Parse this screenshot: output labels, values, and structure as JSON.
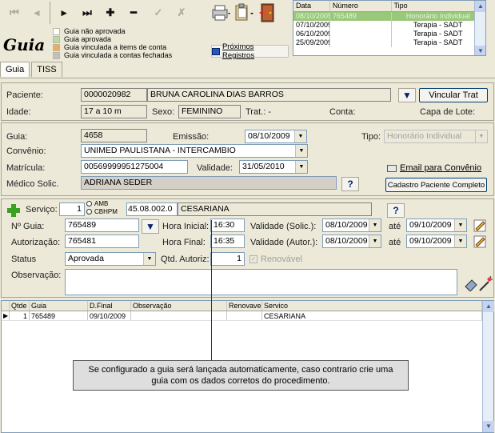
{
  "toolbar": {
    "buttons": [
      {
        "name": "first-icon",
        "glyph": "⏮",
        "disabled": true
      },
      {
        "name": "prev-icon",
        "glyph": "◂",
        "disabled": true
      },
      {
        "name": "next-icon",
        "glyph": "▸",
        "disabled": false
      },
      {
        "name": "last-icon",
        "glyph": "⏭",
        "disabled": false
      },
      {
        "name": "add-icon",
        "glyph": "✚",
        "disabled": false
      },
      {
        "name": "remove-icon",
        "glyph": "━",
        "disabled": false
      },
      {
        "name": "check-icon",
        "glyph": "✓",
        "disabled": true
      },
      {
        "name": "cancel-icon",
        "glyph": "✗",
        "disabled": true
      }
    ]
  },
  "title": "Guia",
  "legend": [
    {
      "label": "Guia não aprovada",
      "color": "#ffffff"
    },
    {
      "label": "Guia aprovada",
      "color": "#b8dca0"
    },
    {
      "label": "Guia vinculada a items de conta",
      "color": "#f4a860"
    },
    {
      "label": "Guia vinculada a contas fechadas",
      "color": "#c0c0c0"
    }
  ],
  "proximos_label": "Próximos Registros",
  "top_grid": {
    "headers": [
      "Data",
      "Número",
      "Tipo"
    ],
    "rows": [
      [
        "08/10/2009",
        "765489",
        "Honorário Individual"
      ],
      [
        "07/10/2009",
        "",
        "Terapia - SADT"
      ],
      [
        "06/10/2009",
        "",
        "Terapia - SADT"
      ],
      [
        "25/09/2009",
        "",
        "Terapia - SADT"
      ]
    ]
  },
  "tabs": [
    "Guia",
    "TISS"
  ],
  "patient": {
    "paciente_label": "Paciente:",
    "paciente_code": "0000020982",
    "paciente_name": "BRUNA CAROLINA DIAS BARROS",
    "vincular_label": "Vincular Trat",
    "idade_label": "Idade:",
    "idade": "17 a 10 m",
    "sexo_label": "Sexo:",
    "sexo": "FEMININO",
    "trat_label": "Trat.: -",
    "conta_label": "Conta:",
    "capa_label": "Capa de Lote:"
  },
  "guia": {
    "guia_label": "Guia:",
    "guia": "4658",
    "emissao_label": "Emissão:",
    "emissao": "08/10/2009",
    "tipo_label": "Tipo:",
    "tipo": "Honorário Individual",
    "convenio_label": "Convênio:",
    "convenio": "UNIMED PAULISTANA - INTERCAMBIO",
    "matricula_label": "Matrícula:",
    "matricula": "00569999951275004",
    "validade_label": "Validade:",
    "validade": "31/05/2010",
    "email_label": "Email para Convênio",
    "medico_label": "Médico Solic.",
    "medico": "ADRIANA SEDER",
    "cadastro_label": "Cadastro Paciente Completo",
    "q_label": "?"
  },
  "servico": {
    "servico_label": "Serviço:",
    "qtd": "1",
    "amb_label": "AMB",
    "cbhpm_label": "CBHPM",
    "code": "45.08.002.0",
    "desc": "CESARIANA",
    "nguia_label": "Nº Guia:",
    "nguia": "765489",
    "hora_ini_label": "Hora Inicial:",
    "hora_ini": "16:30",
    "valid_solic_label": "Validade (Solic.):",
    "valid_solic": "08/10/2009",
    "ate_label": "até",
    "ate1": "09/10/2009",
    "autoriz_label": "Autorização:",
    "autoriz": "765481",
    "hora_fim_label": "Hora Final:",
    "hora_fim": "16:35",
    "valid_autor_label": "Validade (Autor.):",
    "valid_autor": "08/10/2009",
    "ate2": "09/10/2009",
    "status_label": "Status",
    "status": "Aprovada",
    "qtd_autoriz_label": "Qtd. Autoriz:",
    "qtd_autoriz": "1",
    "renovavel_label": "Renovável",
    "obs_label": "Observação:"
  },
  "bottom_grid": {
    "headers": [
      "Qtde",
      "Guia",
      "D.Final",
      "Observação",
      "Renovavel",
      "Servico"
    ],
    "rows": [
      [
        "1",
        "765489",
        "09/10/2009",
        "",
        "",
        "CESARIANA"
      ]
    ]
  },
  "tooltip": "Se configurado a guia será lançada automaticamente, caso contrario crie uma guia com os dados corretos do procedimento."
}
